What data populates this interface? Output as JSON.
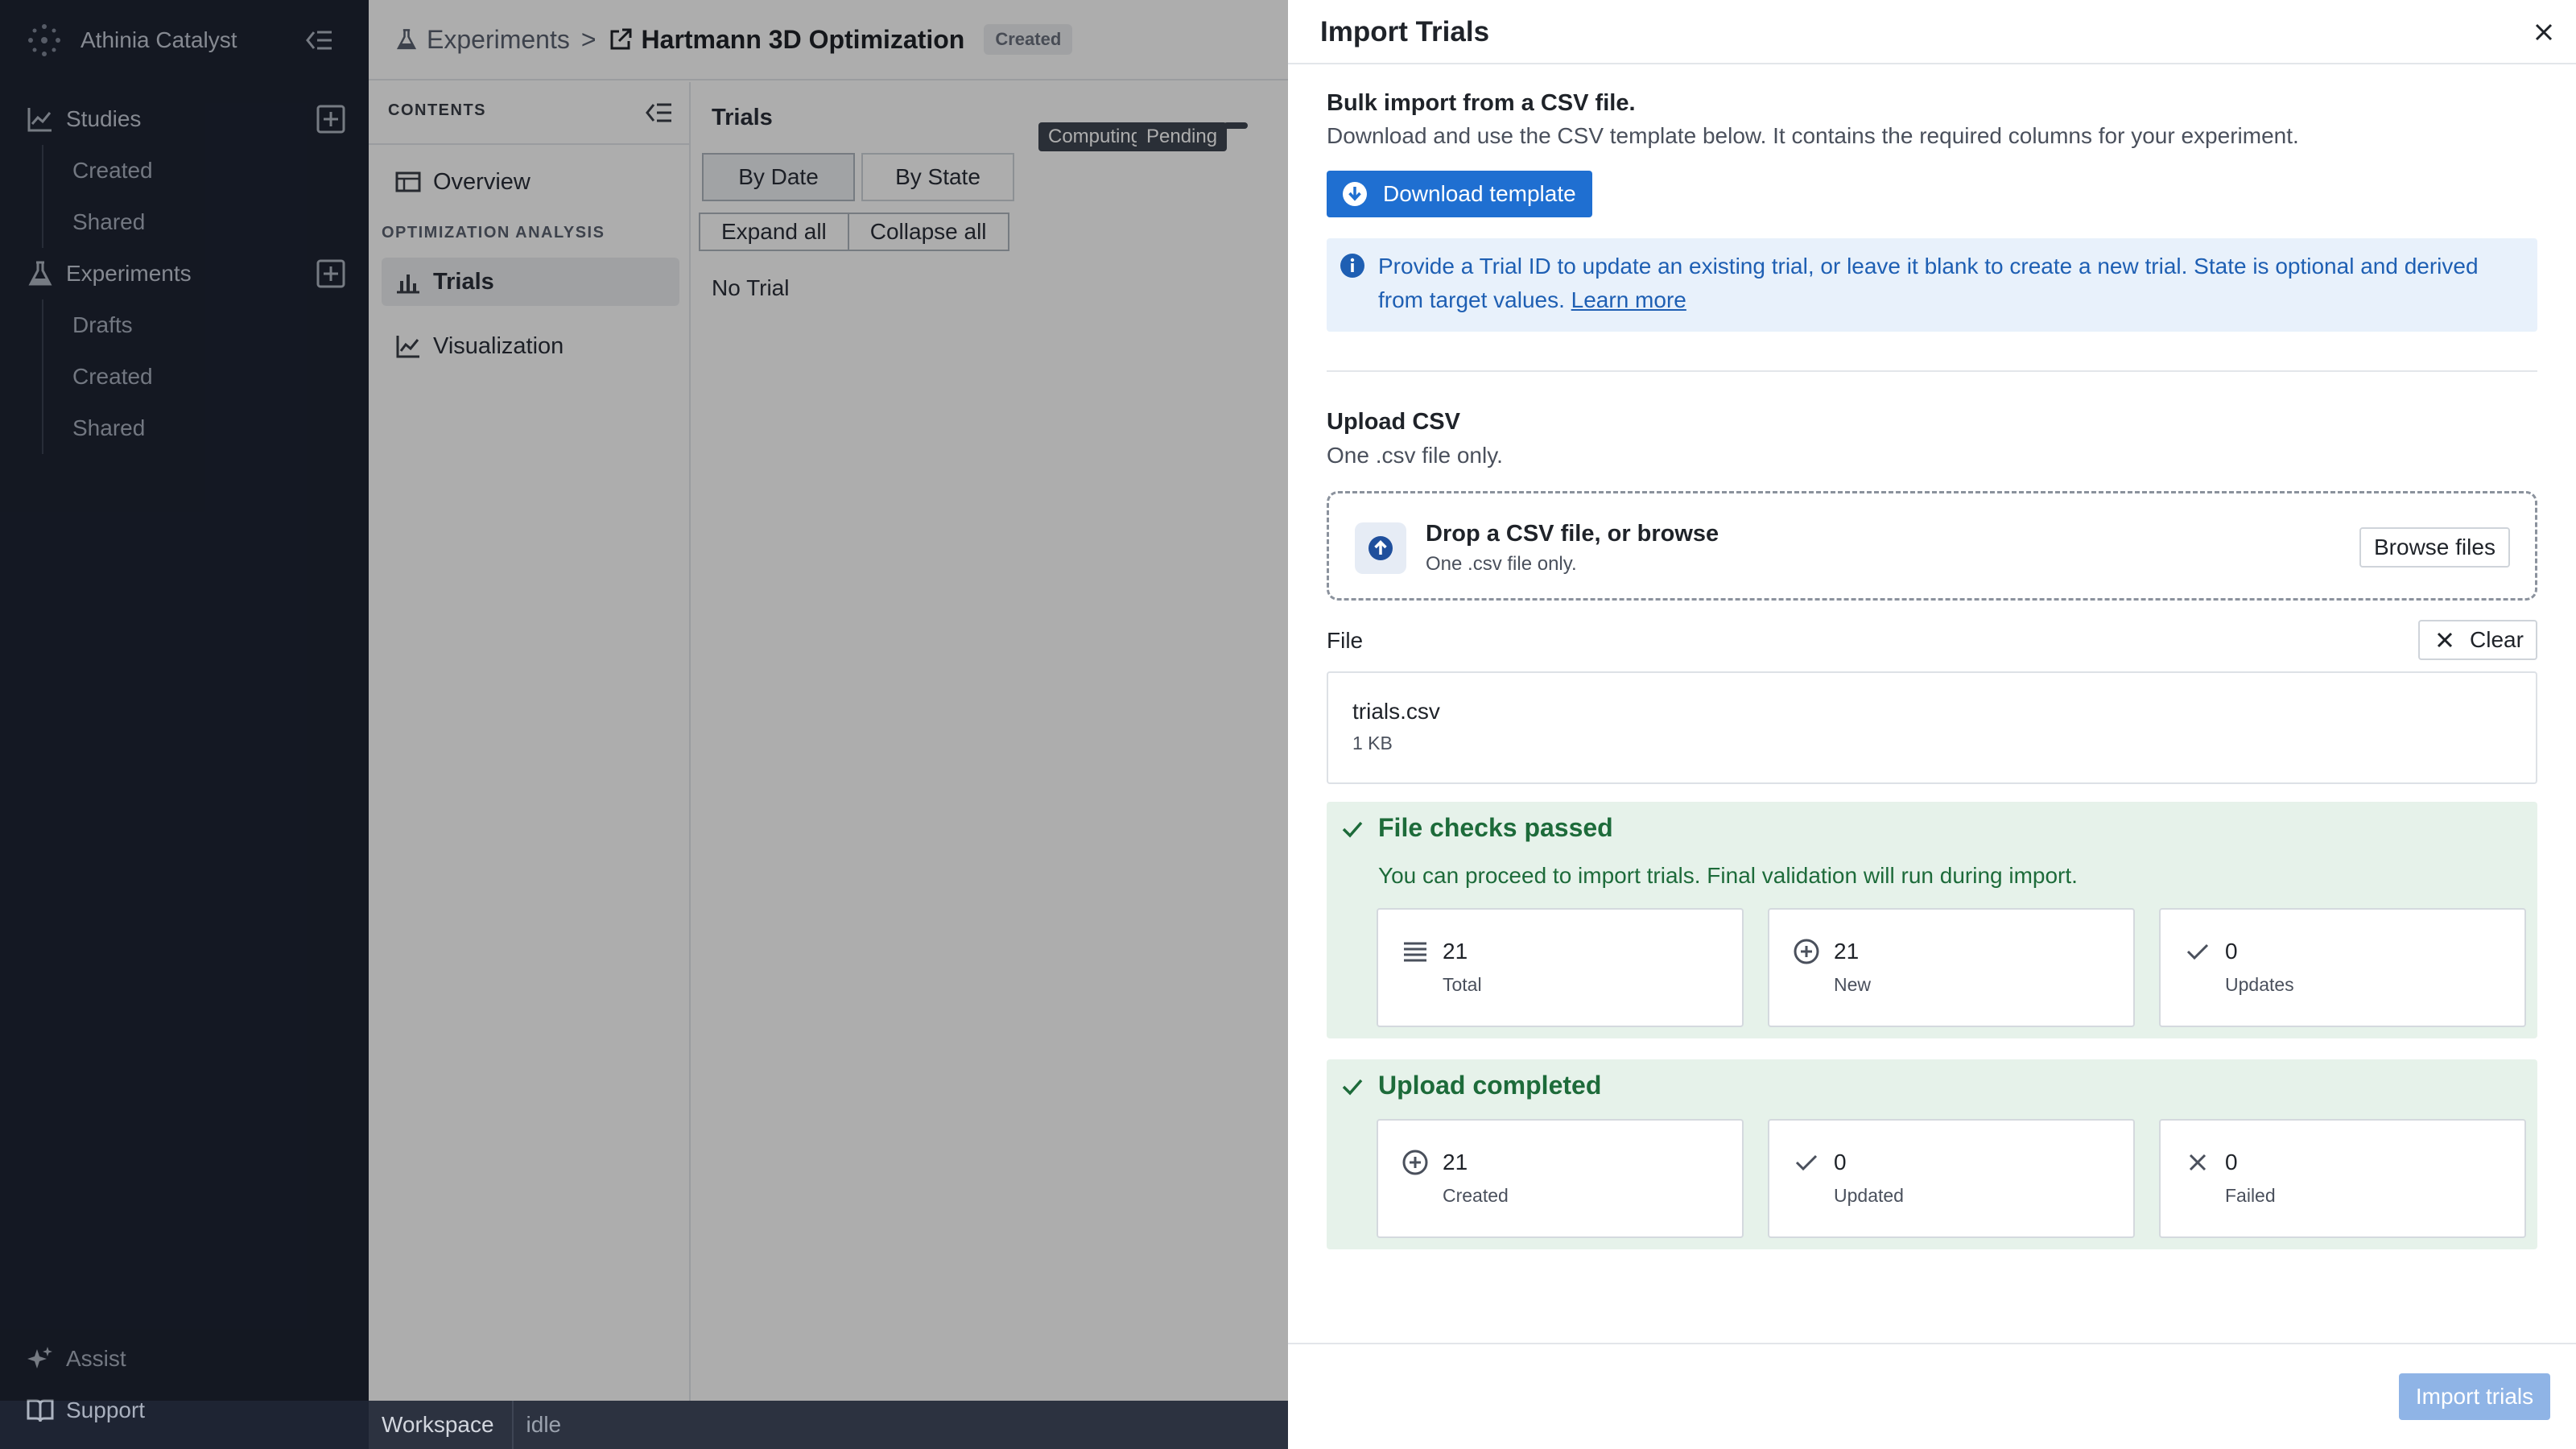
{
  "nav": {
    "brand": "Athinia Catalyst",
    "studies": {
      "label": "Studies",
      "items": [
        "Created",
        "Shared"
      ]
    },
    "experiments": {
      "label": "Experiments",
      "items": [
        "Drafts",
        "Created",
        "Shared"
      ]
    },
    "footer": {
      "assist": "Assist",
      "support": "Support"
    }
  },
  "header": {
    "breadcrumb": "Experiments",
    "separator": ">",
    "title": "Hartmann 3D Optimization",
    "status_badge": "Created"
  },
  "contents": {
    "heading": "CONTENTS",
    "overview": "Overview",
    "group": "OPTIMIZATION ANALYSIS",
    "trials": "Trials",
    "visualization": "Visualization"
  },
  "trials_panel": {
    "title": "Trials",
    "tags": [
      "Computing",
      "Pending"
    ],
    "view_tabs": [
      "By Date",
      "By State"
    ],
    "expand_all": "Expand all",
    "collapse_all": "Collapse all",
    "empty": "No Trial"
  },
  "statusbar": {
    "workspace": "Workspace",
    "state": "idle"
  },
  "drawer": {
    "title": "Import Trials",
    "bulk_heading": "Bulk import from a CSV file.",
    "bulk_desc": "Download and use the CSV template below. It contains the required columns for your experiment.",
    "download_button": "Download template",
    "info_text": "Provide a Trial ID to update an existing trial, or leave it blank to create a new trial. State is optional and derived from target values.",
    "info_link": "Learn more",
    "upload_heading": "Upload CSV",
    "upload_desc": "One .csv file only.",
    "drop_title": "Drop a CSV file, or browse",
    "drop_hint": "One .csv file only.",
    "browse_button": "Browse files",
    "file_label": "File",
    "clear_button": "Clear",
    "file_name": "trials.csv",
    "file_size": "1 KB",
    "checks": {
      "title": "File checks passed",
      "desc": "You can proceed to import trials. Final validation will run during import.",
      "stats": [
        {
          "value": "21",
          "label": "Total",
          "icon": "list-icon"
        },
        {
          "value": "21",
          "label": "New",
          "icon": "plus-circle-icon"
        },
        {
          "value": "0",
          "label": "Updates",
          "icon": "check-icon"
        }
      ]
    },
    "upload_result": {
      "title": "Upload completed",
      "stats": [
        {
          "value": "21",
          "label": "Created",
          "icon": "plus-circle-icon"
        },
        {
          "value": "0",
          "label": "Updated",
          "icon": "check-icon"
        },
        {
          "value": "0",
          "label": "Failed",
          "icon": "x-icon"
        }
      ]
    },
    "import_button": "Import trials"
  },
  "colors": {
    "nav_bg": "#1e2433",
    "accent": "#1f6fd1",
    "success_bg": "#e6f2ea",
    "success_text": "#1d6b3a",
    "info_bg": "#e8f1fb"
  }
}
